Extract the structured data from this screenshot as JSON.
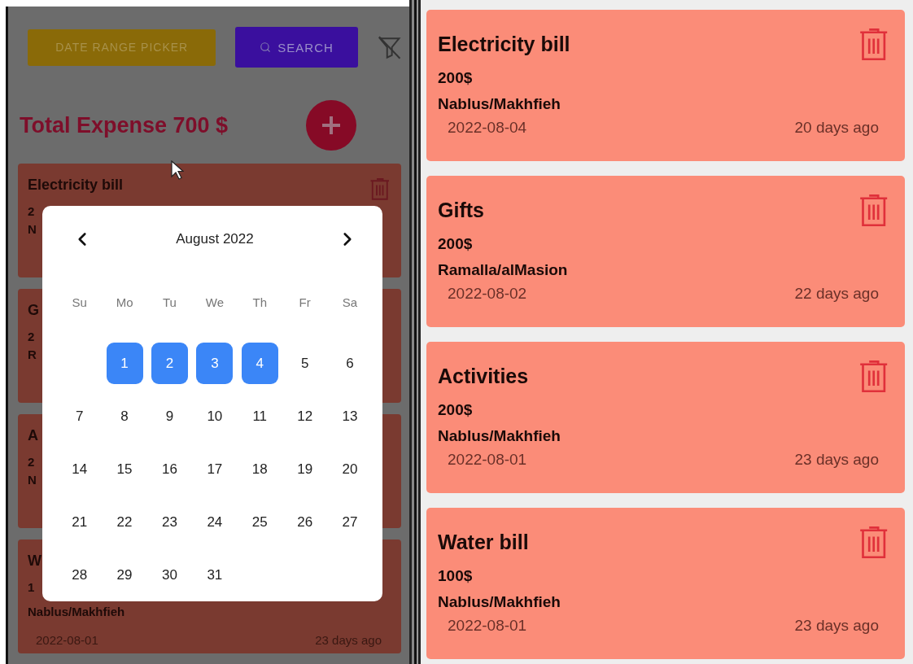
{
  "left_panel": {
    "date_range_button": "DATE RANGE PICKER",
    "search_button": "SEARCH",
    "total": "Total Expense 700 $",
    "cards": [
      {
        "title": "Electricity bill",
        "amount": "2",
        "location": "N",
        "show_delete": true
      },
      {
        "title": "G",
        "amount": "2",
        "location": "R",
        "show_delete": false
      },
      {
        "title": "A",
        "amount": "2",
        "location": "N",
        "show_delete": false
      },
      {
        "title": "W",
        "amount": "1",
        "location": "Nablus/Makhfieh",
        "date": "2022-08-01",
        "age": "23 days ago",
        "show_delete": false
      }
    ]
  },
  "calendar": {
    "month": "August 2022",
    "weekdays": [
      "Su",
      "Mo",
      "Tu",
      "We",
      "Th",
      "Fr",
      "Sa"
    ],
    "weeks": [
      {
        "days": [
          {
            "day": "1",
            "selected": true
          },
          {
            "day": "2",
            "selected": true
          },
          {
            "day": "3",
            "selected": true
          },
          {
            "day": "4",
            "selected": true
          },
          {
            "day": "5",
            "selected": false
          },
          {
            "day": "6",
            "selected": false
          }
        ]
      },
      {
        "days": [
          {
            "day": "7",
            "selected": false
          },
          {
            "day": "8",
            "selected": false
          },
          {
            "day": "9",
            "selected": false
          },
          {
            "day": "10",
            "selected": false
          },
          {
            "day": "11",
            "selected": false
          },
          {
            "day": "12",
            "selected": false
          },
          {
            "day": "13",
            "selected": false
          }
        ]
      },
      {
        "days": [
          {
            "day": "14",
            "selected": false
          },
          {
            "day": "15",
            "selected": false
          },
          {
            "day": "16",
            "selected": false
          },
          {
            "day": "17",
            "selected": false
          },
          {
            "day": "18",
            "selected": false
          },
          {
            "day": "19",
            "selected": false
          },
          {
            "day": "20",
            "selected": false
          }
        ]
      },
      {
        "days": [
          {
            "day": "21",
            "selected": false
          },
          {
            "day": "22",
            "selected": false
          },
          {
            "day": "23",
            "selected": false
          },
          {
            "day": "24",
            "selected": false
          },
          {
            "day": "25",
            "selected": false
          },
          {
            "day": "26",
            "selected": false
          },
          {
            "day": "27",
            "selected": false
          }
        ]
      },
      {
        "days": [
          {
            "day": "28",
            "selected": false
          },
          {
            "day": "29",
            "selected": false
          },
          {
            "day": "30",
            "selected": false
          },
          {
            "day": "31",
            "selected": false
          }
        ]
      }
    ]
  },
  "expenses": [
    {
      "title": "Electricity bill",
      "amount": "200$",
      "location": "Nablus/Makhfieh",
      "date": "2022-08-04",
      "age": "20 days ago"
    },
    {
      "title": "Gifts",
      "amount": "200$",
      "location": "Ramalla/alMasion",
      "date": "2022-08-02",
      "age": "22 days ago"
    },
    {
      "title": "Activities",
      "amount": "200$",
      "location": "Nablus/Makhfieh",
      "date": "2022-08-01",
      "age": "23 days ago"
    },
    {
      "title": "Water bill",
      "amount": "100$",
      "location": "Nablus/Makhfieh",
      "date": "2022-08-01",
      "age": "23 days ago"
    }
  ]
}
